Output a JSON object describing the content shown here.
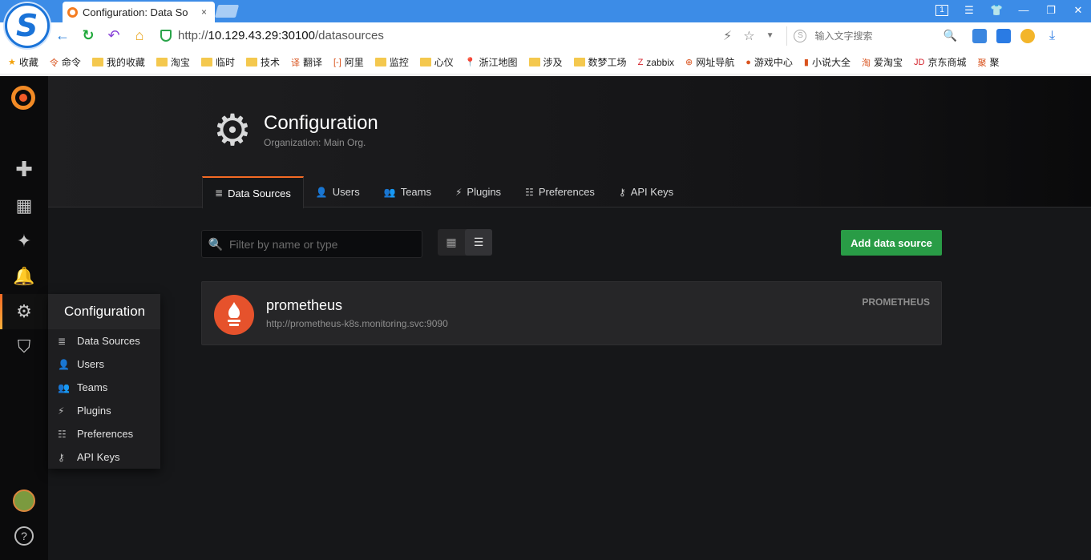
{
  "browser": {
    "tab_title": "Configuration: Data So",
    "tab_close": "×",
    "url_prefix": "http://",
    "url_host": "10.129.43.29:30100",
    "url_path": "/datasources",
    "search_placeholder": "输入文字搜索",
    "search_engine_glyph": "S",
    "window_tab_count": "1",
    "bookmarks": [
      {
        "label": "收藏",
        "icon": "star-icon"
      },
      {
        "label": "命令",
        "icon": "command-icon"
      },
      {
        "label": "我的收藏",
        "icon": "folder-icon"
      },
      {
        "label": "淘宝",
        "icon": "folder-icon"
      },
      {
        "label": "临时",
        "icon": "folder-icon"
      },
      {
        "label": "技术",
        "icon": "folder-icon"
      },
      {
        "label": "翻译",
        "icon": "translate-icon"
      },
      {
        "label": "阿里",
        "icon": "aliyun-icon"
      },
      {
        "label": "监控",
        "icon": "folder-icon"
      },
      {
        "label": "心仪",
        "icon": "folder-icon"
      },
      {
        "label": "浙江地图",
        "icon": "map-pin-icon"
      },
      {
        "label": "涉及",
        "icon": "folder-icon"
      },
      {
        "label": "数梦工场",
        "icon": "folder-icon"
      },
      {
        "label": "zabbix",
        "icon": "zabbix-icon"
      },
      {
        "label": "网址导航",
        "icon": "globe-icon"
      },
      {
        "label": "游戏中心",
        "icon": "game-icon"
      },
      {
        "label": "小说大全",
        "icon": "book-icon"
      },
      {
        "label": "爱淘宝",
        "icon": "taobao-icon"
      },
      {
        "label": "京东商城",
        "icon": "jd-icon"
      },
      {
        "label": "聚",
        "icon": "ju-icon"
      }
    ]
  },
  "sidemenu": {
    "config_header": "Configuration",
    "config_items": [
      {
        "label": "Data Sources",
        "icon": "database-icon"
      },
      {
        "label": "Users",
        "icon": "user-icon"
      },
      {
        "label": "Teams",
        "icon": "users-icon"
      },
      {
        "label": "Plugins",
        "icon": "plug-icon"
      },
      {
        "label": "Preferences",
        "icon": "sliders-icon"
      },
      {
        "label": "API Keys",
        "icon": "key-icon"
      }
    ],
    "help_glyph": "?"
  },
  "header": {
    "title": "Configuration",
    "subtitle": "Organization: Main Org."
  },
  "tabs": [
    {
      "label": "Data Sources",
      "active": true
    },
    {
      "label": "Users"
    },
    {
      "label": "Teams"
    },
    {
      "label": "Plugins"
    },
    {
      "label": "Preferences"
    },
    {
      "label": "API Keys"
    }
  ],
  "toolbar": {
    "filter_placeholder": "Filter by name or type",
    "add_button_label": "Add data source",
    "view_mode": "list"
  },
  "datasources": [
    {
      "name": "prometheus",
      "url": "http://prometheus-k8s.monitoring.svc:9090",
      "type": "PROMETHEUS"
    }
  ],
  "colors": {
    "accent": "#f46a24",
    "primary_button": "#299c46",
    "prometheus": "#e6522c",
    "browser_blue": "#3c8ce7"
  }
}
